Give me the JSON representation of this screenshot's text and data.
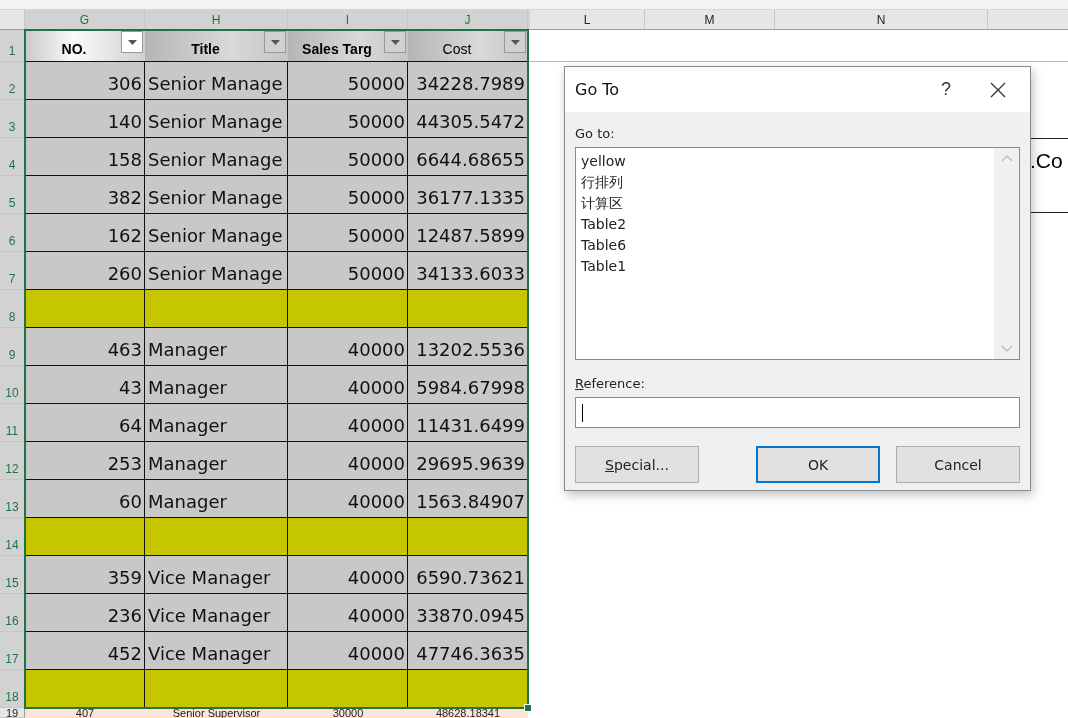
{
  "column_headers": [
    {
      "label": "G",
      "selected": true
    },
    {
      "label": "H",
      "selected": true
    },
    {
      "label": "I",
      "selected": true
    },
    {
      "label": "J",
      "selected": true
    },
    {
      "label": "L",
      "selected": false
    },
    {
      "label": "M",
      "selected": false
    },
    {
      "label": "N",
      "selected": false
    }
  ],
  "table": {
    "header_row": {
      "number": "1",
      "selected": true
    },
    "headers": [
      {
        "label": "NO.",
        "active": true
      },
      {
        "label": "Title",
        "active": false
      },
      {
        "label": "Sales Targ",
        "active": false
      },
      {
        "label": "Cost",
        "active": false
      }
    ],
    "rows": [
      {
        "number": "2",
        "selected": true,
        "kind": "data",
        "cells": [
          "306",
          "Senior Manage",
          "50000",
          "34228.7989"
        ]
      },
      {
        "number": "3",
        "selected": true,
        "kind": "data",
        "cells": [
          "140",
          "Senior Manage",
          "50000",
          "44305.5472"
        ]
      },
      {
        "number": "4",
        "selected": true,
        "kind": "data",
        "cells": [
          "158",
          "Senior Manage",
          "50000",
          "6644.68655"
        ]
      },
      {
        "number": "5",
        "selected": true,
        "kind": "data",
        "cells": [
          "382",
          "Senior Manage",
          "50000",
          "36177.1335"
        ]
      },
      {
        "number": "6",
        "selected": true,
        "kind": "data",
        "cells": [
          "162",
          "Senior Manage",
          "50000",
          "12487.5899"
        ]
      },
      {
        "number": "7",
        "selected": true,
        "kind": "data",
        "cells": [
          "260",
          "Senior Manage",
          "50000",
          "34133.6033"
        ]
      },
      {
        "number": "8",
        "selected": true,
        "kind": "highlight"
      },
      {
        "number": "9",
        "selected": true,
        "kind": "data",
        "cells": [
          "463",
          "Manager",
          "40000",
          "13202.5536"
        ]
      },
      {
        "number": "10",
        "selected": true,
        "kind": "data",
        "cells": [
          "43",
          "Manager",
          "40000",
          "5984.67998"
        ]
      },
      {
        "number": "11",
        "selected": true,
        "kind": "data",
        "cells": [
          "64",
          "Manager",
          "40000",
          "11431.6499"
        ]
      },
      {
        "number": "12",
        "selected": true,
        "kind": "data",
        "cells": [
          "253",
          "Manager",
          "40000",
          "29695.9639"
        ]
      },
      {
        "number": "13",
        "selected": true,
        "kind": "data",
        "cells": [
          "60",
          "Manager",
          "40000",
          "1563.84907"
        ]
      },
      {
        "number": "14",
        "selected": true,
        "kind": "highlight"
      },
      {
        "number": "15",
        "selected": true,
        "kind": "data",
        "cells": [
          "359",
          "Vice Manager",
          "40000",
          "6590.73621"
        ]
      },
      {
        "number": "16",
        "selected": true,
        "kind": "data",
        "cells": [
          "236",
          "Vice Manager",
          "40000",
          "33870.0945"
        ]
      },
      {
        "number": "17",
        "selected": true,
        "kind": "data",
        "cells": [
          "452",
          "Vice Manager",
          "40000",
          "47746.3635"
        ]
      },
      {
        "number": "18",
        "selected": true,
        "kind": "highlight"
      }
    ]
  },
  "partial_row": {
    "number": "19",
    "selected": false,
    "cells": [
      "407",
      "Senior Supervisor",
      "30000",
      "48628.18341"
    ]
  },
  "side_cell": {
    "text": ".Co"
  },
  "dialog": {
    "title": "Go To",
    "help": "?",
    "goto_label": "Go to:",
    "items": [
      {
        "label": "yellow",
        "selected": false
      },
      {
        "label": "行排列",
        "selected": false
      },
      {
        "label": "计算区",
        "selected": false
      },
      {
        "label": "Table2",
        "selected": false
      },
      {
        "label": "Table6",
        "selected": false
      },
      {
        "label": "Table1",
        "selected": false
      }
    ],
    "reference_label": "Reference:",
    "buttons": [
      {
        "label": "Special...",
        "default": false
      },
      {
        "label": "OK",
        "default": true
      },
      {
        "label": "Cancel",
        "default": false
      }
    ]
  }
}
